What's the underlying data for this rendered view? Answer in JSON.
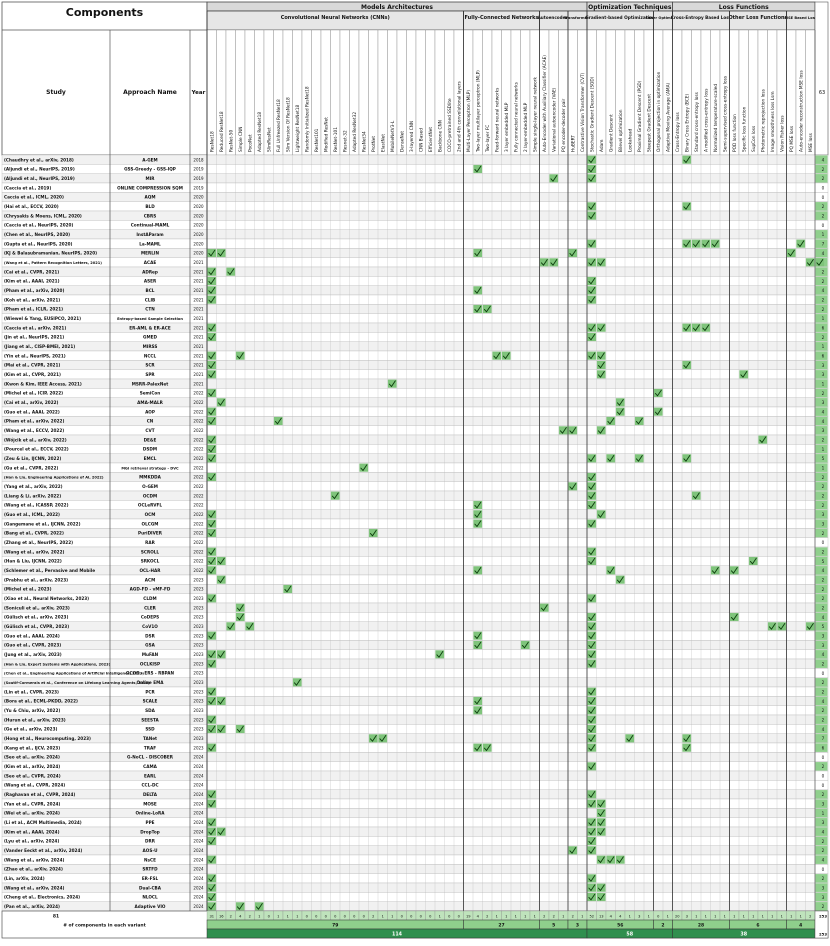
{
  "header": {
    "components_title": "Components",
    "col_study": "Study",
    "col_approach": "Approach Name",
    "col_year": "Year",
    "top_groups": [
      {
        "label": "Models Architectures"
      },
      {
        "label": "Optimization Techniques"
      },
      {
        "label": "Loss Functions"
      }
    ],
    "sub_groups": [
      {
        "label": "Convolutional Neural Networks (CNNs)"
      },
      {
        "label": "Fully-Connected Networks"
      },
      {
        "label": "Autoencoders"
      },
      {
        "label": "Transformers"
      },
      {
        "label": "Gradient-based Optimization"
      },
      {
        "label": "Other Optimizers"
      },
      {
        "label": "Cross-Entropy Based Loss"
      },
      {
        "label": "Other Loss Functions"
      },
      {
        "label": "MSE Based Loss"
      }
    ],
    "count_header": "63"
  },
  "components": [
    "ResNet18",
    "Reduced ResNet18",
    "ResNet-50",
    "Simple CNN",
    "PocoNet",
    "Adapted ResNet18",
    "SlimResNet",
    "Full Unfreezed ResNet18",
    "Slim Version Of ResNet18",
    "Lightweight ResNet18",
    "Randomly Initialized ResNet18",
    "ResNet101",
    "Modified ResNet",
    "ResNet-101",
    "Resnet-32",
    "Adapted ResNet32",
    "ResNet34",
    "ProtNet",
    "ElastNet",
    "MobileNetV3-L",
    "DenseNet",
    "3-layered CNN",
    "CNN Based",
    "EfficientNet",
    "Backbone CNN",
    "COCO-pretrained SSDlite",
    "2nd and 4th convolutional layers",
    "Multi-Layer Perceptron (MLP)",
    "Two-layer multilayer perceptron (MLP)",
    "Two-layer FC",
    "Feed-forward neural networks",
    "3 layer embedded MLP",
    "Fully connected neural networks",
    "2 layer-embedded MLP",
    "Simple single-layer neural network",
    "Auto-Encoder with Auxiliary Classifier (ACAE)",
    "Variational autoencoder (VAE)",
    "PQ encoder-decoder pair",
    "HuBERT",
    "Contrastive Vision Transformer (CVT)",
    "Stochastic Gradient Descent (SGD)",
    "Adam",
    "Gradient Descent",
    "Bilevel optimization",
    "Lookahead",
    "Proximal Gradient Descent (PGD)",
    "Steepest Gradient Descent",
    "Orthogonal projection in optimization",
    "Adaptive Moving Average (AMA)",
    "Cross-Entropy loss",
    "Binary Cross Entropy (BCE)",
    "Standard cross-entropy loss",
    "A modified cross-entropy loss",
    "Normalized temperature-scaled",
    "Semi-supervised cross-entropy loss",
    "POD loss function",
    "Specific loss function",
    "SupCon loss",
    "Photometric reprojection loss",
    "Image smoothness loss Lsm",
    "Vision Fisher loss",
    "PQ MSE loss",
    "Auto-encoder reconstruction MSE loss",
    "MSE loss"
  ],
  "rows": [
    {
      "study": "(Chaudhry et al., arXiv, 2018)",
      "approach": "A-GEM",
      "year": "2018",
      "count": "4"
    },
    {
      "study": "(Aljundi et al., NeurIPS, 2019)",
      "approach": "GSS-Greedy - GSS-IQP",
      "year": "2019",
      "count": "2"
    },
    {
      "study": "(Aljundi et al., NeurIPS, 2019)",
      "approach": "MIR",
      "year": "2019",
      "count": "2"
    },
    {
      "study": "(Caccia et al., 2019)",
      "approach": "ONLINE COMPRESSION SQM",
      "year": "2019",
      "count": "0"
    },
    {
      "study": "Caccia et al., ICML, 2020)",
      "approach": "AQM",
      "year": "2020",
      "count": "0"
    },
    {
      "study": "(Hai et al., ECCV, 2020)",
      "approach": "BLD",
      "year": "2020",
      "count": "2"
    },
    {
      "study": "(Chrysakis & Moens, ICML, 2020)",
      "approach": "CBRS",
      "year": "2020",
      "count": "2"
    },
    {
      "study": "(Caccia et al., NeurIPS, 2020)",
      "approach": "Continual-MAML",
      "year": "2020",
      "count": "0"
    },
    {
      "study": "(Chen et al., NeurIPS, 2020)",
      "approach": "InstAParam",
      "year": "2020",
      "count": "1"
    },
    {
      "study": "(Gupta et al., NeurIPS, 2020)",
      "approach": "La-MAML",
      "year": "2020",
      "count": "7"
    },
    {
      "study": "(KJ & Balasubramanian, NeurIPS, 2020)",
      "approach": "MERLIN",
      "year": "2020",
      "count": "4"
    },
    {
      "study": "(Wang et al., Pattern Recognition Letters, 2021)",
      "approach": "ACAE",
      "year": "2021",
      "count": "6"
    },
    {
      "study": "(Cai et al., CVPR, 2021)",
      "approach": "ADRep",
      "year": "2021",
      "count": "2"
    },
    {
      "study": "(Kim et al., AAAI, 2021)",
      "approach": "ASER",
      "year": "2021",
      "count": "2"
    },
    {
      "study": "(Pham et al., arXiv, 2020)",
      "approach": "BCL",
      "year": "2021",
      "count": "4"
    },
    {
      "study": "(Koh et al., arXiv, 2021)",
      "approach": "CLIB",
      "year": "2021",
      "count": "2"
    },
    {
      "study": "(Pham et al., ICLR, 2021)",
      "approach": "CTN",
      "year": "2021",
      "count": "2"
    },
    {
      "study": "(Wiewel & Yang, EUSIPCO, 2021)",
      "approach": "Entropy-based Sample Selection",
      "year": "2021",
      "count": "1"
    },
    {
      "study": "(Caccia et al., arXiv, 2021)",
      "approach": "ER-AML & ER-ACE",
      "year": "2021",
      "count": "6"
    },
    {
      "study": "(Jin et al., NeurIPS, 2021)",
      "approach": "GMED",
      "year": "2021",
      "count": "2"
    },
    {
      "study": "(Jiang et al., CISP-BMEI, 2021)",
      "approach": "MIRSS",
      "year": "2021",
      "count": "1"
    },
    {
      "study": "(Yin et al., NeurIPS, 2021)",
      "approach": "NCCL",
      "year": "2021",
      "count": "6"
    },
    {
      "study": "(Mai et al., CVPR, 2021)",
      "approach": "SCR",
      "year": "2021",
      "count": "3"
    },
    {
      "study": "(Kim et al., CVPR, 2021)",
      "approach": "SPR",
      "year": "2021",
      "count": "3"
    },
    {
      "study": "(Kwon & Kim, IEEE Access, 2021)",
      "approach": "MSRR-PalexNet",
      "year": "2021",
      "count": "1"
    },
    {
      "study": "(Michel et al., ICIP, 2022)",
      "approach": "SemiCon",
      "year": "2022",
      "count": "2"
    },
    {
      "study": "(Cai et al., arXiv, 2022)",
      "approach": "AMA-MALR",
      "year": "2022",
      "count": "3"
    },
    {
      "study": "(Guo et al., AAAI, 2022)",
      "approach": "AOP",
      "year": "2022",
      "count": "4"
    },
    {
      "study": "(Pham et al., arXiv, 2022)",
      "approach": "CN",
      "year": "2022",
      "count": "4"
    },
    {
      "study": "(Wang et al., ECCV, 2022)",
      "approach": "CVT",
      "year": "2022",
      "count": "3"
    },
    {
      "study": "(Wójcik et al., arXiv, 2022)",
      "approach": "DE&E",
      "year": "2022",
      "count": "2"
    },
    {
      "study": "(Pourcel et al., ECCV, 2022)",
      "approach": "DSDM",
      "year": "2022",
      "count": "1"
    },
    {
      "study": "(Zeu & Lin, IJCNN, 2022)",
      "approach": "EMCL",
      "year": "2022",
      "count": "5"
    },
    {
      "study": "(Gu et al., CVPR, 2022)",
      "approach": "MGI retrieval strategy - DVC",
      "year": "2022",
      "count": "1"
    },
    {
      "study": "(Han & Liu, Engineering Applications of AI, 2022)",
      "approach": "MMKDDA",
      "year": "2022",
      "count": "2"
    },
    {
      "study": "(Yang et al., arXiv, 2022)",
      "approach": "O-GEM",
      "year": "2022",
      "count": "2"
    },
    {
      "study": "(Liang & Li, arXiv, 2022)",
      "approach": "OCDM",
      "year": "2022",
      "count": "2"
    },
    {
      "study": "(Wang et al., ICASSP, 2022)",
      "approach": "OCLeRVFL",
      "year": "2022",
      "count": "2"
    },
    {
      "study": "(Guo et al., ICML, 2022)",
      "approach": "OCM",
      "year": "2022",
      "count": "3"
    },
    {
      "study": "(Gangemane et al., IJCNN, 2022)",
      "approach": "OLCGM",
      "year": "2022",
      "count": "3"
    },
    {
      "study": "(Bang et al., CVPR, 2022)",
      "approach": "PuriDIVER",
      "year": "2022",
      "count": "2"
    },
    {
      "study": "(Zhang et al., NeurIPS, 2022)",
      "approach": "RAR",
      "year": "2022",
      "count": "0"
    },
    {
      "study": "(Wang et al., arXiv, 2022)",
      "approach": "SCROLL",
      "year": "2022",
      "count": "2"
    },
    {
      "study": "(Han & Liu, IJCNN, 2022)",
      "approach": "SRKOCL",
      "year": "2022",
      "count": "5"
    },
    {
      "study": "(Schlemer et al., Pervasive and Mobile",
      "approach": "OCL-HAR",
      "year": "2022",
      "count": "4"
    },
    {
      "study": "(Prabhu et al., arXiv, 2023)",
      "approach": "ACM",
      "year": "2023",
      "count": "2"
    },
    {
      "study": "(Michel et al., 2023)",
      "approach": "AGD-FD - vMF-FD",
      "year": "2023",
      "count": "2"
    },
    {
      "study": "(Xiao et al., Neural Networks, 2023)",
      "approach": "CLDM",
      "year": "2023",
      "count": "2"
    },
    {
      "study": "(Soniculi et al., arXiv, 2023)",
      "approach": "CLER",
      "year": "2023",
      "count": "2"
    },
    {
      "study": "(Gülisch et al., arXiv, 2023)",
      "approach": "CoDEPS",
      "year": "2023",
      "count": "4"
    },
    {
      "study": "(Gülisch et al., CVPR, 2023)",
      "approach": "CoV1O",
      "year": "2023",
      "count": "5"
    },
    {
      "study": "(Guo et al., AAAI, 2024)",
      "approach": "DSR",
      "year": "2023",
      "count": "3"
    },
    {
      "study": "(Guo et al., CVPR, 2023)",
      "approach": "GSA",
      "year": "2023",
      "count": "3"
    },
    {
      "study": "(Jung et al., arXiv, 2023)",
      "approach": "MuFAN",
      "year": "2023",
      "count": "4"
    },
    {
      "study": "(Han & Liu, Expert Systems with Applications, 2023)",
      "approach": "OCLKISP",
      "year": "2023",
      "count": "2"
    },
    {
      "study": "(Chen et al., Engineering Applications of Artificial Intelligence, 2023)",
      "approach": "OCOD - ERS - RBPAN",
      "year": "2023",
      "count": "0"
    },
    {
      "study": "(Soutif-Cormerais et al., Conference on Lifelong Learning Agents, 2023)",
      "approach": "Online EMA",
      "year": "2023",
      "count": "2"
    },
    {
      "study": "(Lin et al., CVPR, 2023)",
      "approach": "PCR",
      "year": "2023",
      "count": "2"
    },
    {
      "study": "(Bora et al., ECML-PKDD, 2022)",
      "approach": "SCALE",
      "year": "2023",
      "count": "4"
    },
    {
      "study": "(Yu & Chiu, arXiv, 2022)",
      "approach": "SDA",
      "year": "2023",
      "count": "2"
    },
    {
      "study": "(Hurun et al., arXiv, 2023)",
      "approach": "SEESTA",
      "year": "2023",
      "count": "2"
    },
    {
      "study": "(Ge et al., arXiv, 2023)",
      "approach": "SSD",
      "year": "2023",
      "count": "4"
    },
    {
      "study": "(Hong et al., Neurocomputing, 2023)",
      "approach": "TANet",
      "year": "2023",
      "count": "7"
    },
    {
      "study": "(Kang et al., IJCV, 2023)",
      "approach": "TRAF",
      "year": "2023",
      "count": "6"
    },
    {
      "study": "(Seo et al., arXiv, 2024)",
      "approach": "G-NoCL - DISCOBER",
      "year": "2024",
      "count": "0"
    },
    {
      "study": "(Kim et al., arXiv, 2024)",
      "approach": "CAMA",
      "year": "2024",
      "count": "2"
    },
    {
      "study": "(Seo et al., CVPR, 2024)",
      "approach": "EARL",
      "year": "2024",
      "count": "0"
    },
    {
      "study": "(Wang et al., CVPR, 2024)",
      "approach": "CCL-DC",
      "year": "2024",
      "count": "0"
    },
    {
      "study": "(Raghavan et al., CVPR, 2024)",
      "approach": "DELTA",
      "year": "2024",
      "count": "2"
    },
    {
      "study": "(Yan et al., CVPR, 2024)",
      "approach": "MOSE",
      "year": "2024",
      "count": "3"
    },
    {
      "study": "(Wei et al., arXiv, 2024)",
      "approach": "Online-LoRA",
      "year": "2024",
      "count": "1"
    },
    {
      "study": "(Li et al., ACM Multimedia, 2024)",
      "approach": "PPE",
      "year": "2024",
      "count": "3"
    },
    {
      "study": "(Kim et al., AAAI, 2024)",
      "approach": "DropTop",
      "year": "2024",
      "count": "4"
    },
    {
      "study": "(Lyu et al., arXiv, 2024)",
      "approach": "DRR",
      "year": "2024",
      "count": "2"
    },
    {
      "study": "(Vander Eeckt et al., arXiv, 2024)",
      "approach": "AOS-U",
      "year": "2024",
      "count": "2"
    },
    {
      "study": "(Wang et al., arXiv, 2024)",
      "approach": "NsCE",
      "year": "2024",
      "count": "4"
    },
    {
      "study": "(Zhao et al., arXiv, 2024)",
      "approach": "SRTFD",
      "year": "2024",
      "count": "0"
    },
    {
      "study": "(Lin, arXiv, 2024)",
      "approach": "ER-FSL",
      "year": "2024",
      "count": "2"
    },
    {
      "study": "(Wang et al., arXiv, 2024)",
      "approach": "Dual-CBA",
      "year": "2024",
      "count": "3"
    },
    {
      "study": "(Cheng et al., Electronics, 2024)",
      "approach": "NLOCL",
      "year": "2024",
      "count": "3"
    },
    {
      "study": "(Pan et al., arXiv, 2024)",
      "approach": "Adaptive VIO",
      "year": "2024",
      "count": "2"
    }
  ],
  "checks": [
    [
      0,
      40,
      50
    ],
    [
      1,
      28,
      40
    ],
    [
      2,
      36,
      40
    ],
    [
      3
    ],
    [
      4
    ],
    [
      5,
      40,
      50
    ],
    [
      6,
      40
    ],
    [
      7
    ],
    [
      8
    ],
    [
      9,
      40,
      50,
      51,
      52,
      53,
      62
    ],
    [
      10,
      0,
      1,
      28,
      38,
      61
    ],
    [
      11,
      35,
      36,
      40,
      41,
      63,
      64
    ],
    [
      12,
      0,
      2
    ],
    [
      13,
      0,
      40
    ],
    [
      14,
      0,
      28,
      40
    ],
    [
      15,
      0,
      40
    ],
    [
      16,
      28,
      29
    ],
    [
      17
    ],
    [
      18,
      0,
      40,
      41,
      50,
      51,
      52
    ],
    [
      19,
      0,
      40
    ],
    [
      20
    ],
    [
      21,
      0,
      3,
      30,
      31,
      40,
      41
    ],
    [
      22,
      0,
      41,
      50
    ],
    [
      23,
      0,
      41,
      56
    ],
    [
      24,
      19
    ],
    [
      25,
      0,
      47
    ],
    [
      26,
      1,
      43
    ],
    [
      27,
      0,
      43,
      47
    ],
    [
      28,
      0,
      7,
      42,
      45
    ],
    [
      29,
      37,
      38,
      41
    ],
    [
      30,
      0,
      58
    ],
    [
      31,
      0
    ],
    [
      32,
      0,
      40,
      42,
      45,
      50
    ],
    [
      33,
      16
    ],
    [
      34,
      0,
      40
    ],
    [
      35,
      38,
      40
    ],
    [
      36,
      13,
      40,
      51
    ],
    [
      37,
      28,
      40
    ],
    [
      38,
      0,
      28,
      41
    ],
    [
      39,
      0,
      28,
      40
    ],
    [
      40,
      0,
      17
    ],
    [
      41
    ],
    [
      42,
      0,
      40
    ],
    [
      43,
      0,
      1,
      40,
      57
    ],
    [
      44,
      0,
      28,
      42,
      53,
      55
    ],
    [
      45,
      1,
      43
    ],
    [
      46,
      8
    ],
    [
      47,
      0,
      40
    ],
    [
      48,
      3,
      35
    ],
    [
      49,
      3,
      40,
      55
    ],
    [
      50,
      2,
      4,
      40,
      59,
      60,
      63
    ],
    [
      51,
      0,
      28,
      40
    ],
    [
      52,
      28,
      33,
      40
    ],
    [
      53,
      0,
      1,
      40,
      24
    ],
    [
      54,
      0,
      40
    ],
    [
      55
    ],
    [
      56,
      9
    ],
    [
      57,
      0,
      40
    ],
    [
      58,
      0,
      1,
      28,
      40
    ],
    [
      59,
      28,
      40
    ],
    [
      60,
      0,
      40
    ],
    [
      61,
      0,
      1,
      3,
      40
    ],
    [
      62,
      17,
      18,
      40,
      44,
      50
    ],
    [
      63,
      0,
      28,
      29,
      40,
      50
    ],
    [
      64
    ],
    [
      65,
      40
    ],
    [
      66
    ],
    [
      67
    ],
    [
      68,
      0,
      40
    ],
    [
      69,
      0,
      40,
      41
    ],
    [
      70,
      41
    ],
    [
      71,
      0,
      40,
      41
    ],
    [
      72,
      0,
      1,
      40,
      41
    ],
    [
      73,
      0,
      40
    ],
    [
      74,
      38,
      40
    ],
    [
      75,
      0,
      41,
      42,
      43
    ],
    [
      76
    ],
    [
      77,
      0,
      40
    ],
    [
      78,
      0,
      40,
      41
    ],
    [
      79,
      0,
      40,
      41
    ],
    [
      80,
      0,
      3,
      5
    ]
  ],
  "component_counts": [
    "31",
    "16",
    "2",
    "4",
    "2",
    "1",
    "0",
    "1",
    "1",
    "1",
    "0",
    "0",
    "0",
    "0",
    "0",
    "0",
    "0",
    "2",
    "1",
    "1",
    "0",
    "0",
    "0",
    "0",
    "1",
    "0",
    "0",
    "19",
    "4",
    "2",
    "1",
    "1",
    "1",
    "1",
    "1",
    "2",
    "2",
    "1",
    "2",
    "1",
    "52",
    "13",
    "4",
    "4",
    "1",
    "3",
    "1",
    "0",
    "1",
    "20",
    "3",
    "1",
    "1",
    "1",
    "1",
    "1",
    "1",
    "1",
    "1",
    "1",
    "1",
    "1",
    "1",
    "2"
  ],
  "footer": {
    "total_rows_label": "81",
    "variant_label": "# of components in each variant",
    "sub_totals": [
      "79",
      "27",
      "5",
      "3",
      "56",
      "2",
      "28",
      "6",
      "4"
    ],
    "top_totals": [
      "114",
      "58",
      "38"
    ],
    "right_totals": [
      "253",
      "253"
    ]
  },
  "colors": {
    "check_bg": "#7fc47b",
    "check_dark": "#2e7d32",
    "header_bg": "#e6e6e6",
    "group_bg": "#d9d9d9",
    "row_alt": "#f1f1f1",
    "total_bg": "#8fcf8c",
    "total_dark": "#2f8f4e"
  }
}
